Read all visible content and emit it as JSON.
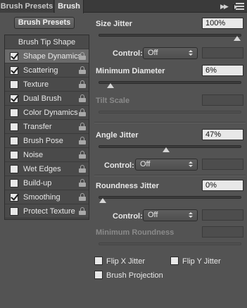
{
  "tabs": [
    {
      "label": "Brush Presets",
      "active": false
    },
    {
      "label": "Brush",
      "active": true
    }
  ],
  "panel_menu": {
    "collapse_icon": "double-chevron-right-icon",
    "menu_icon": "panel-menu-icon"
  },
  "presets_button": "Brush Presets",
  "list": {
    "header": "Brush Tip Shape",
    "items": [
      {
        "label": "Shape Dynamics",
        "checked": true,
        "selected": true
      },
      {
        "label": "Scattering",
        "checked": true,
        "selected": false
      },
      {
        "label": "Texture",
        "checked": false,
        "selected": false
      },
      {
        "label": "Dual Brush",
        "checked": true,
        "selected": false
      },
      {
        "label": "Color Dynamics",
        "checked": false,
        "selected": false
      },
      {
        "label": "Transfer",
        "checked": false,
        "selected": false
      },
      {
        "label": "Brush Pose",
        "checked": false,
        "selected": false
      },
      {
        "label": "Noise",
        "checked": false,
        "selected": false
      },
      {
        "label": "Wet Edges",
        "checked": false,
        "selected": false
      },
      {
        "label": "Build-up",
        "checked": false,
        "selected": false
      },
      {
        "label": "Smoothing",
        "checked": true,
        "selected": false
      },
      {
        "label": "Protect Texture",
        "checked": false,
        "selected": false
      }
    ]
  },
  "settings": {
    "size_jitter": {
      "label": "Size Jitter",
      "value": "100%",
      "level": 1.0
    },
    "size_control": {
      "label": "Control:",
      "value": "Off"
    },
    "minimum_diameter": {
      "label": "Minimum Diameter",
      "value": "6%",
      "level": 0.06
    },
    "tilt_scale": {
      "label": "Tilt Scale",
      "value": ""
    },
    "angle_jitter": {
      "label": "Angle Jitter",
      "value": "47%",
      "level": 0.47
    },
    "angle_control": {
      "label": "Control:",
      "value": "Off"
    },
    "roundness_jitter": {
      "label": "Roundness Jitter",
      "value": "0%",
      "level": 0.0
    },
    "roundness_control": {
      "label": "Control:",
      "value": "Off"
    },
    "minimum_roundness": {
      "label": "Minimum Roundness",
      "value": ""
    },
    "flip_x": {
      "label": "Flip X Jitter",
      "checked": false
    },
    "flip_y": {
      "label": "Flip Y Jitter",
      "checked": false
    },
    "brush_projection": {
      "label": "Brush Projection",
      "checked": false
    }
  }
}
